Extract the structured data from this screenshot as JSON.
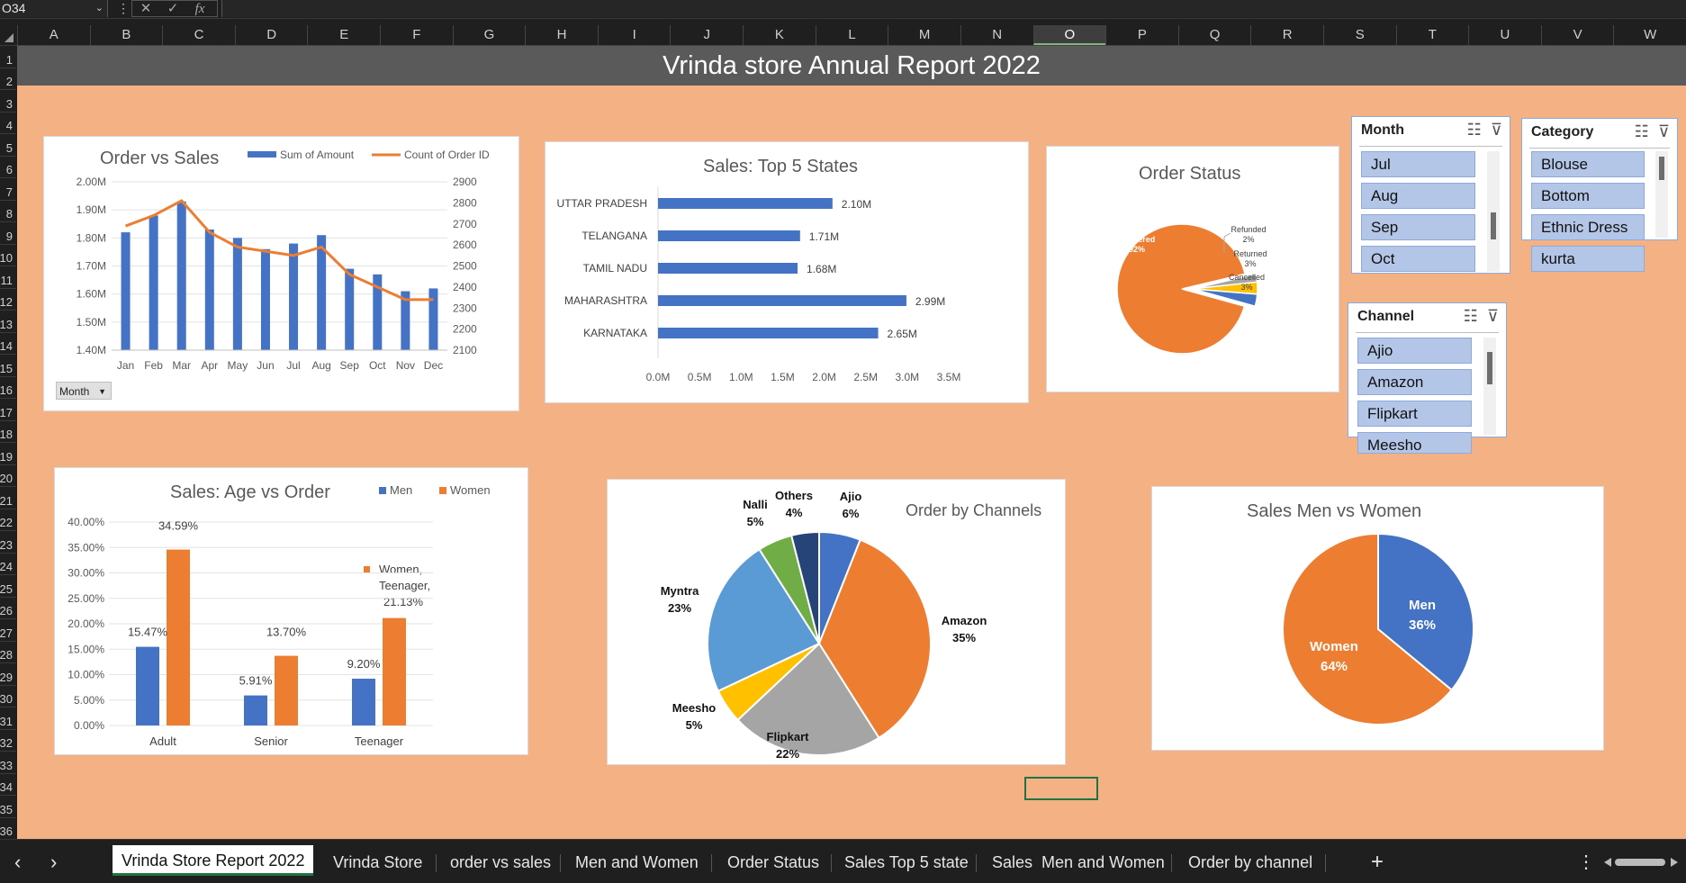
{
  "formula_bar": {
    "name_box": "O34",
    "dots": "⋮",
    "icon_cancel": "✕",
    "icon_enter": "✓",
    "icon_fx": "fx",
    "formula": ""
  },
  "columns": [
    "A",
    "B",
    "C",
    "D",
    "E",
    "F",
    "G",
    "H",
    "I",
    "J",
    "K",
    "L",
    "M",
    "N",
    "O",
    "P",
    "Q",
    "R",
    "S",
    "T",
    "U",
    "V",
    "W"
  ],
  "selected_column": "O",
  "rows": [
    "1",
    "2",
    "3",
    "4",
    "5",
    "6",
    "7",
    "8",
    "9",
    "10",
    "11",
    "12",
    "13",
    "14",
    "15",
    "16",
    "17",
    "18",
    "19",
    "20",
    "21",
    "22",
    "23",
    "24",
    "25",
    "26",
    "27",
    "28",
    "29",
    "30",
    "31",
    "32",
    "33",
    "34",
    "35",
    "36"
  ],
  "report": {
    "title": "Vrinda store Annual Report 2022"
  },
  "colors": {
    "blue": "#4472c4",
    "orange": "#ed7d31",
    "gray": "#a5a5a5",
    "yellow": "#ffc000",
    "lightblue": "#5b9bd5",
    "green": "#70ad47",
    "navy": "#264478",
    "background": "#f4b183",
    "titlebar": "#5a5a5a"
  },
  "order_vs_sales": {
    "month_filter_label": "Month",
    "chart_data": {
      "type": "bar",
      "title": "Order vs Sales",
      "categories": [
        "Jan",
        "Feb",
        "Mar",
        "Apr",
        "May",
        "Jun",
        "Jul",
        "Aug",
        "Sep",
        "Oct",
        "Nov",
        "Dec"
      ],
      "y_ticks": [
        "2.00M",
        "1.90M",
        "1.80M",
        "1.70M",
        "1.60M",
        "1.50M",
        "1.40M"
      ],
      "y2_ticks": [
        "2900",
        "2800",
        "2700",
        "2600",
        "2500",
        "2400",
        "2300",
        "2200",
        "2100"
      ],
      "ylim": [
        1.4,
        2.0
      ],
      "y2lim": [
        2100,
        2900
      ],
      "legend_position": "top-right",
      "series": [
        {
          "name": "Sum of Amount",
          "type": "bar",
          "axis": "left",
          "values": [
            1.82,
            1.88,
            1.93,
            1.83,
            1.8,
            1.76,
            1.78,
            1.81,
            1.69,
            1.67,
            1.61,
            1.62
          ]
        },
        {
          "name": "Count of Order ID",
          "type": "line",
          "axis": "right",
          "values": [
            2690,
            2740,
            2810,
            2660,
            2590,
            2570,
            2550,
            2590,
            2460,
            2400,
            2340,
            2340
          ]
        }
      ]
    }
  },
  "top_states": {
    "chart_data": {
      "type": "bar",
      "orientation": "horizontal",
      "title": "Sales: Top 5 States",
      "categories": [
        "UTTAR PRADESH",
        "TELANGANA",
        "TAMIL NADU",
        "MAHARASHTRA",
        "KARNATAKA"
      ],
      "values": [
        2.1,
        1.71,
        1.68,
        2.99,
        2.65
      ],
      "labels": [
        "2.10M",
        "1.71M",
        "1.68M",
        "2.99M",
        "2.65M"
      ],
      "x_ticks": [
        "0.0M",
        "0.5M",
        "1.0M",
        "1.5M",
        "2.0M",
        "2.5M",
        "3.0M",
        "3.5M"
      ],
      "xlim": [
        0,
        3.5
      ]
    }
  },
  "order_status": {
    "chart_data": {
      "type": "pie",
      "title": "Order Status",
      "categories": [
        "Delivered",
        "Refunded",
        "Returned",
        "Cancelled"
      ],
      "values": [
        92,
        2,
        3,
        3
      ],
      "labels": [
        "92%",
        "2%",
        "3%",
        "3%"
      ]
    }
  },
  "slicers": {
    "month": {
      "header": "Month",
      "items": [
        "Jul",
        "Aug",
        "Sep",
        "Oct"
      ]
    },
    "category": {
      "header": "Category",
      "items": [
        "Blouse",
        "Bottom",
        "Ethnic Dress",
        "kurta"
      ]
    },
    "channel": {
      "header": "Channel",
      "items": [
        "Ajio",
        "Amazon",
        "Flipkart",
        "Meesho"
      ]
    },
    "icon_multiselect": "☷",
    "icon_clear_filter": "⊽"
  },
  "age_vs_order": {
    "annotation": {
      "line1": "Women,",
      "line2": "Teenager,",
      "line3": "21.13%"
    },
    "chart_data": {
      "type": "bar",
      "title": "Sales: Age vs Order",
      "categories": [
        "Adult",
        "Senior",
        "Teenager"
      ],
      "y_ticks": [
        "40.00%",
        "35.00%",
        "30.00%",
        "25.00%",
        "20.00%",
        "15.00%",
        "10.00%",
        "5.00%",
        "0.00%"
      ],
      "ylim": [
        0,
        40
      ],
      "legend_position": "top-right",
      "series": [
        {
          "name": "Men",
          "values": [
            15.47,
            5.91,
            9.2
          ],
          "labels": [
            "15.47%",
            "5.91%",
            "9.20%"
          ]
        },
        {
          "name": "Women",
          "values": [
            34.59,
            13.7,
            21.13
          ],
          "labels": [
            "34.59%",
            "13.70%",
            ""
          ]
        }
      ]
    }
  },
  "order_by_channels": {
    "chart_data": {
      "type": "pie",
      "title": "Order by Channels",
      "categories": [
        "Ajio",
        "Amazon",
        "Flipkart",
        "Meesho",
        "Myntra",
        "Nalli",
        "Others"
      ],
      "values": [
        6,
        35,
        22,
        5,
        23,
        5,
        4
      ],
      "labels": [
        "6%",
        "35%",
        "22%",
        "5%",
        "23%",
        "5%",
        "4%"
      ]
    }
  },
  "men_vs_women": {
    "chart_data": {
      "type": "pie",
      "title": "Sales Men vs Women",
      "categories": [
        "Men",
        "Women"
      ],
      "values": [
        36,
        64
      ],
      "labels": [
        "36%",
        "64%"
      ]
    }
  },
  "sheet_tabs": {
    "nav_prev": "‹",
    "nav_next": "›",
    "tabs": [
      "Vrinda Store Report 2022",
      "Vrinda Store",
      "order vs sales",
      "Men and Women",
      "Order Status",
      "Sales Top 5 state",
      "Sales  Men and Women",
      "Order by channel"
    ],
    "active_tab": "Vrinda Store Report 2022",
    "add_sheet": "+",
    "more_options": "⋮"
  }
}
